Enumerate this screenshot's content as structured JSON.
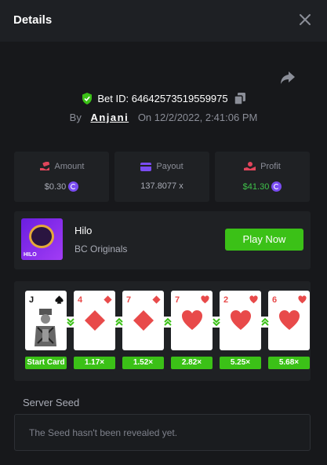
{
  "header": {
    "title": "Details"
  },
  "bet": {
    "id_text": "Bet ID: 64642573519559975",
    "by_label": "By",
    "username": "Anjani",
    "on_label": "On",
    "datetime": "12/2/2022, 2:41:06 PM"
  },
  "stats": {
    "amount": {
      "label": "Amount",
      "value": "$0.30"
    },
    "payout": {
      "label": "Payout",
      "value": "137.8077 x"
    },
    "profit": {
      "label": "Profit",
      "value": "$41.30"
    }
  },
  "game": {
    "name": "Hilo",
    "provider": "BC Originals",
    "thumb_text": "HILO",
    "play_label": "Play Now"
  },
  "cards": [
    {
      "rank": "J",
      "suit": "spade",
      "tag": "Start Card"
    },
    {
      "rank": "4",
      "suit": "diamond",
      "tag": "1.17×"
    },
    {
      "rank": "7",
      "suit": "diamond",
      "tag": "1.52×"
    },
    {
      "rank": "7",
      "suit": "heart",
      "tag": "2.82×"
    },
    {
      "rank": "2",
      "suit": "heart",
      "tag": "5.25×"
    },
    {
      "rank": "6",
      "suit": "heart",
      "tag": "5.68×"
    }
  ],
  "guesses": [
    "lower",
    "higher",
    "higher",
    "lower",
    "higher"
  ],
  "seed": {
    "title": "Server Seed",
    "message": "The Seed hasn't been revealed yet."
  },
  "colors": {
    "accent_green": "#3bc117",
    "profit_green": "#3fc24a",
    "amount_icon": "#e0455b",
    "payout_icon": "#7a4cf2",
    "coin": "#7a4cf2",
    "suit_red": "#e84a4a"
  }
}
